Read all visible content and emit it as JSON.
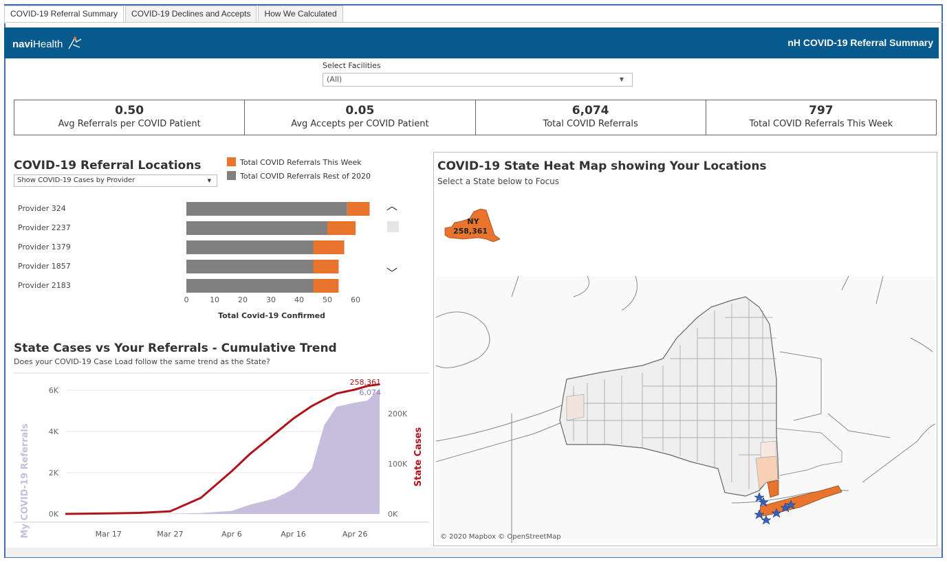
{
  "tabs": [
    "COVID-19 Referral Summary",
    "COVID-19 Declines and Accepts",
    "How We Calculated"
  ],
  "banner": {
    "logo_prefix": "navi",
    "logo_suffix": "Health",
    "title": "nH COVID-19 Referral Summary",
    "color": "#065a8e"
  },
  "filter": {
    "label": "Select Facilities",
    "value": "(All)"
  },
  "kpis": [
    {
      "value": "0.50",
      "label": "Avg Referrals per COVID Patient"
    },
    {
      "value": "0.05",
      "label": "Avg Accepts per COVID Patient"
    },
    {
      "value": "6,074",
      "label": "Total COVID Referrals"
    },
    {
      "value": "797",
      "label": "Total COVID Referrals This Week"
    }
  ],
  "referral_locations": {
    "title": "COVID-19  Referral Locations",
    "dropdown": "Show COVID-19 Cases by Provider",
    "legend": [
      "Total COVID Referrals This Week",
      "Total COVID Referrals Rest of 2020"
    ],
    "colors": {
      "this_week": "#e8742e",
      "rest": "#808080"
    }
  },
  "trend": {
    "title": "State Cases vs Your Referrals - Cumulative Trend",
    "subtitle": "Does your COVID-19 Case Load follow the same trend as the State?",
    "end_label_state": "258,361",
    "end_label_referrals": "6,074",
    "left_axis_label": "My COVID-19 Referrals",
    "right_axis_label": "State Cases"
  },
  "map": {
    "title": "COVID-19 State Heat Map showing Your Locations",
    "subtitle": "Select a State below to Focus",
    "state_abbr": "NY",
    "state_value": "258,361",
    "attribution": "© 2020 Mapbox  © OpenStreetMap"
  },
  "chart_data": [
    {
      "type": "bar",
      "title": "COVID-19  Referral Locations",
      "xlabel": "Total Covid-19 Confirmed",
      "xlim": [
        0,
        70
      ],
      "xticks": [
        "0",
        "10",
        "20",
        "30",
        "40",
        "50",
        "60"
      ],
      "categories": [
        "Provider 324",
        "Provider 2237",
        "Provider 1379",
        "Provider 1857",
        "Provider 2183"
      ],
      "series": [
        {
          "name": "Total COVID Referrals Rest of 2020",
          "values": [
            57,
            50,
            45,
            45,
            45
          ]
        },
        {
          "name": "Total COVID Referrals This Week",
          "values": [
            8,
            10,
            11,
            9,
            9
          ]
        }
      ],
      "stacked": true
    },
    {
      "type": "area",
      "title": "State Cases vs Your Referrals - Cumulative Trend",
      "x": [
        "Mar 10",
        "Mar 17",
        "Mar 22",
        "Mar 27",
        "Apr 1",
        "Apr 6",
        "Apr 9",
        "Apr 13",
        "Apr 16",
        "Apr 19",
        "Apr 21",
        "Apr 23",
        "Apr 26",
        "Apr 28",
        "Apr 30"
      ],
      "x_ticks": [
        "Mar 17",
        "Mar 27",
        "Apr 6",
        "Apr 16",
        "Apr 26"
      ],
      "series": [
        {
          "name": "My COVID-19 Referrals",
          "axis": "left",
          "values": [
            0,
            0,
            0,
            10,
            40,
            150,
            450,
            750,
            1200,
            2200,
            4300,
            5200,
            5400,
            5500,
            6074
          ]
        },
        {
          "name": "State Cases",
          "axis": "right",
          "values": [
            0,
            1000,
            2000,
            5000,
            32000,
            85000,
            120000,
            160000,
            190000,
            215000,
            228000,
            240000,
            248000,
            255000,
            258361
          ]
        }
      ],
      "left_ticks": [
        "0K",
        "2K",
        "4K",
        "6K"
      ],
      "right_ticks": [
        "0K",
        "100K",
        "200K"
      ],
      "ylim_left": [
        0,
        6400
      ],
      "ylim_right": [
        0,
        263000
      ],
      "colors": {
        "referrals": "#c7bedd",
        "state": "#b0141a"
      }
    }
  ]
}
